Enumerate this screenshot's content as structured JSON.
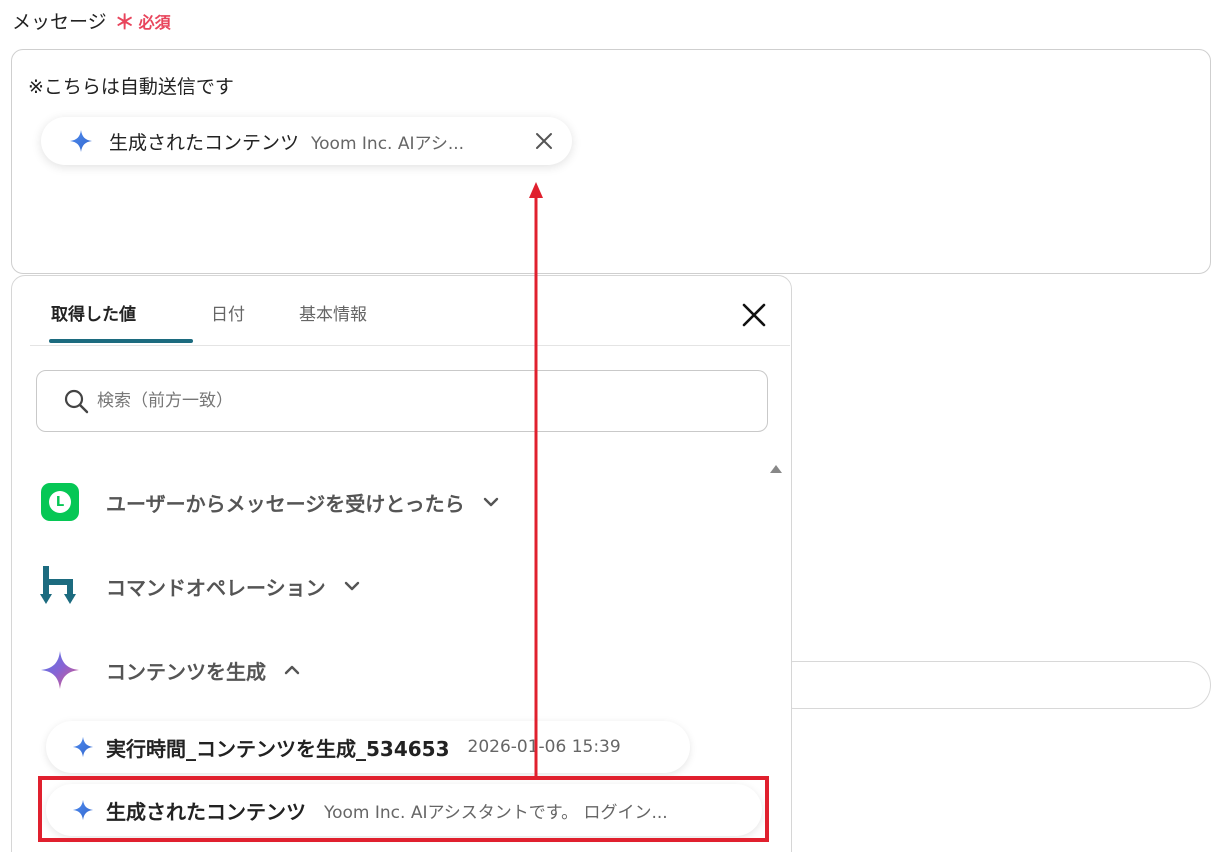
{
  "field": {
    "label": "メッセージ",
    "required_mark": "＊",
    "required_text": "必須"
  },
  "message": {
    "text": "※こちらは自動送信です",
    "token": {
      "label": "生成されたコンテンツ",
      "sub": "Yoom Inc. AIアシ...",
      "icon": "sparkle-icon"
    }
  },
  "panel": {
    "tabs": [
      {
        "label": "取得した値",
        "active": true
      },
      {
        "label": "日付",
        "active": false
      },
      {
        "label": "基本情報",
        "active": false
      }
    ],
    "search_placeholder": "検索（前方一致）",
    "groups": [
      {
        "label": "ユーザーからメッセージを受けとったら",
        "icon": "line-app-icon",
        "expanded": false
      },
      {
        "label": "コマンドオペレーション",
        "icon": "command-operation-icon",
        "expanded": false
      },
      {
        "label": "コンテンツを生成",
        "icon": "gemini-sparkle-icon",
        "expanded": true
      }
    ],
    "items": [
      {
        "label": "実行時間_コンテンツを生成_534653",
        "sub": "2026-01-06 15:39"
      },
      {
        "label": "生成されたコンテンツ",
        "sub": "Yoom Inc. AIアシスタントです。 ログイン..."
      }
    ]
  },
  "colors": {
    "accent": "#1c6b7f",
    "required": "#e8455c",
    "highlight": "#e0202e",
    "line_green": "#06c755"
  }
}
